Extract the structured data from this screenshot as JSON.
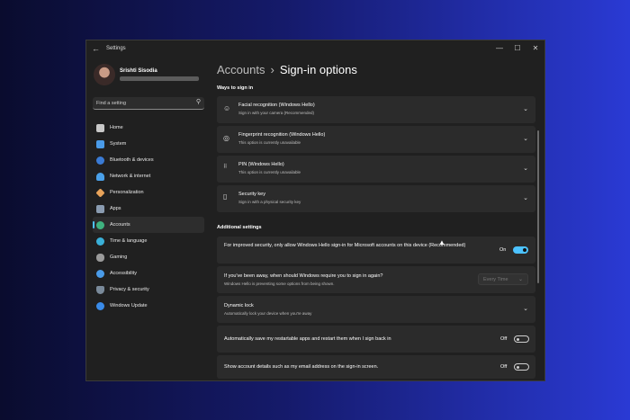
{
  "window": {
    "title": "Settings",
    "controls": [
      "—",
      "☐",
      "✕"
    ]
  },
  "profile": {
    "name": "Srishti Sisodia"
  },
  "search": {
    "placeholder": "Find a setting"
  },
  "sidebar": {
    "items": [
      {
        "label": "Home",
        "icon": "home-icon",
        "color": "#c8c8c8"
      },
      {
        "label": "System",
        "icon": "system-icon",
        "color": "#4a9be8"
      },
      {
        "label": "Bluetooth & devices",
        "icon": "bluetooth-icon",
        "color": "#3a7bd5"
      },
      {
        "label": "Network & internet",
        "icon": "network-icon",
        "color": "#4aa0e8"
      },
      {
        "label": "Personalization",
        "icon": "brush-icon",
        "color": "#e8a35a"
      },
      {
        "label": "Apps",
        "icon": "apps-icon",
        "color": "#8a9bb0"
      },
      {
        "label": "Accounts",
        "icon": "accounts-icon",
        "color": "#3fb27f",
        "active": true
      },
      {
        "label": "Time & language",
        "icon": "globe-icon",
        "color": "#3ab0d8"
      },
      {
        "label": "Gaming",
        "icon": "gaming-icon",
        "color": "#9a9a9a"
      },
      {
        "label": "Accessibility",
        "icon": "accessibility-icon",
        "color": "#4a9be8"
      },
      {
        "label": "Privacy & security",
        "icon": "shield-icon",
        "color": "#7a8a9a"
      },
      {
        "label": "Windows Update",
        "icon": "update-icon",
        "color": "#3a8be8"
      }
    ]
  },
  "breadcrumb": {
    "parent": "Accounts",
    "separator": "›",
    "current": "Sign-in options"
  },
  "ways_to_sign_in": {
    "title": "Ways to sign in",
    "items": [
      {
        "title": "Facial recognition (Windows Hello)",
        "subtitle": "Sign in with your camera (Recommended)",
        "icon": "face-icon"
      },
      {
        "title": "Fingerprint recognition (Windows Hello)",
        "subtitle": "This option is currently unavailable",
        "icon": "fingerprint-icon"
      },
      {
        "title": "PIN (Windows Hello)",
        "subtitle": "This option is currently unavailable",
        "icon": "pin-icon"
      },
      {
        "title": "Security key",
        "subtitle": "Sign in with a physical security key",
        "icon": "usb-key-icon"
      }
    ]
  },
  "additional_settings": {
    "title": "Additional settings",
    "windows_hello_only": {
      "text": "For improved security, only allow Windows Hello sign-in for Microsoft accounts on this device (Recommended)",
      "state": "On"
    },
    "require_sign_in": {
      "text": "If you've been away, when should Windows require you to sign in again?",
      "subtext": "Windows Hello is preventing some options from being shown.",
      "value": "Every Time"
    },
    "dynamic_lock": {
      "text": "Dynamic lock",
      "subtext": "Automatically lock your device when you're away"
    },
    "restart_apps": {
      "text": "Automatically save my restartable apps and restart them when I sign back in",
      "state": "Off"
    },
    "show_account_details": {
      "text": "Show account details such as my email address on the sign-in screen.",
      "state": "Off"
    }
  }
}
